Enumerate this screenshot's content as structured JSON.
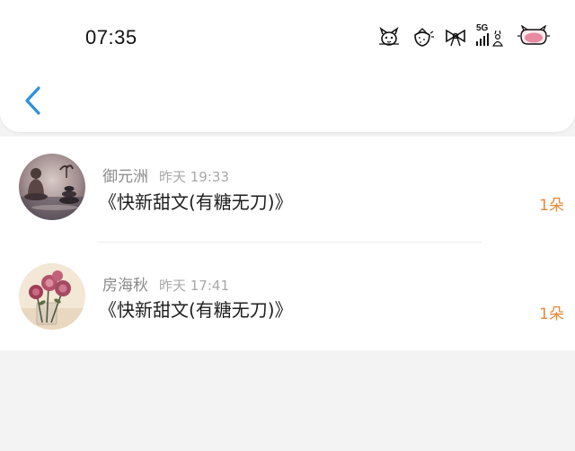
{
  "status_bar": {
    "time": "07:35",
    "network_label": "5G",
    "icons": [
      "sticker-cat-icon",
      "sticker-strawberry-icon",
      "sticker-bow-icon",
      "signal-5g-icon",
      "battery-pig-icon"
    ]
  },
  "nav": {
    "back_icon": "chevron-left-icon",
    "accent_color": "#2b8fe0"
  },
  "items": [
    {
      "user": "御元洲",
      "time": "昨天 19:33",
      "title": "《快新甜文(有糖无刀)》",
      "count": "1朵",
      "avatar_icon": "buddha-statue-avatar"
    },
    {
      "user": "房海秋",
      "time": "昨天 17:41",
      "title": "《快新甜文(有糖无刀)》",
      "count": "1朵",
      "avatar_icon": "roses-vase-avatar"
    }
  ],
  "colors": {
    "count_color": "#e58a3a",
    "name_color": "#8a8a8a",
    "background": "#f4f3f4"
  }
}
